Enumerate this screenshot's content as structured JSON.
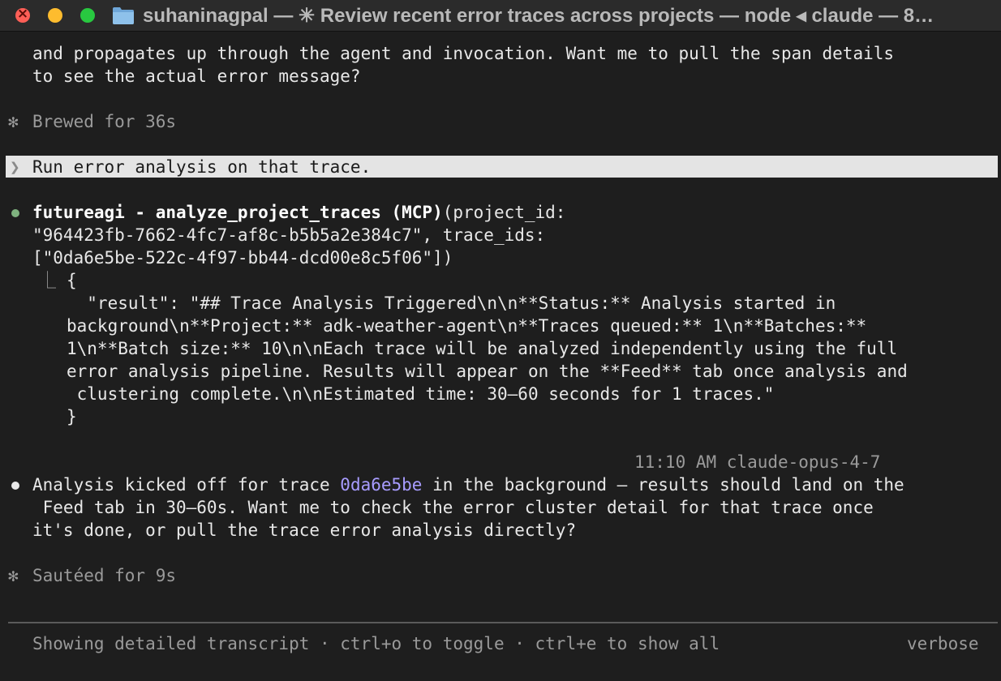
{
  "window": {
    "title": "suhaninagpal — ✳ Review recent error traces across projects — node ◂ claude — 8…"
  },
  "transcript": {
    "prev_text_1": "and propagates up through the agent and invocation. Want me to pull the span details",
    "prev_text_2": "to see the actual error message?",
    "status_1_icon": "✻",
    "status_1": "Brewed for 36s",
    "user_prompt_glyph": "❯",
    "user_prompt": "Run error analysis on that trace.",
    "tool_call_name": "futureagi - analyze_project_traces (MCP)",
    "tool_call_args_1": "(project_id:",
    "tool_call_args_2": "\"964423fb-7662-4fc7-af8c-b5b5a2e384c7\", trace_ids:",
    "tool_call_args_3": "[\"0da6e5be-522c-4f97-bb44-dcd00e8c5f06\"])",
    "result_connector": "⎿",
    "result_lines": [
      "{",
      "  \"result\": \"## Trace Analysis Triggered\\n\\n**Status:** Analysis started in",
      "background\\n**Project:** adk-weather-agent\\n**Traces queued:** 1\\n**Batches:**",
      "1\\n**Batch size:** 10\\n\\nEach trace will be analyzed independently using the full",
      "error analysis pipeline. Results will appear on the **Feed** tab once analysis and",
      " clustering complete.\\n\\nEstimated time: 30—60 seconds for 1 traces.\"",
      "}"
    ],
    "timestamp": "11:10 AM claude-opus-4-7",
    "reply_pre": "Analysis kicked off for trace ",
    "reply_trace_id": "0da6e5be",
    "reply_post": " in the background — results should land on the",
    "reply_2": " Feed tab in 30–60s. Want me to check the error cluster detail for that trace once",
    "reply_3": "it's done, or pull the trace error analysis directly?",
    "status_2_icon": "✻",
    "status_2": "Sautéed for 9s"
  },
  "footer": {
    "hint": "Showing detailed transcript · ctrl+o to toggle · ctrl+e to show all",
    "mode": "verbose"
  },
  "colors": {
    "background": "#1e1e1e",
    "prompt_highlight": "#e4e4e4",
    "tool_dot": "#7fb27f",
    "link": "#a89cff"
  },
  "icons": {
    "close": "close-icon",
    "minimize": "minimize-icon",
    "zoom": "zoom-icon",
    "folder": "folder-icon"
  }
}
